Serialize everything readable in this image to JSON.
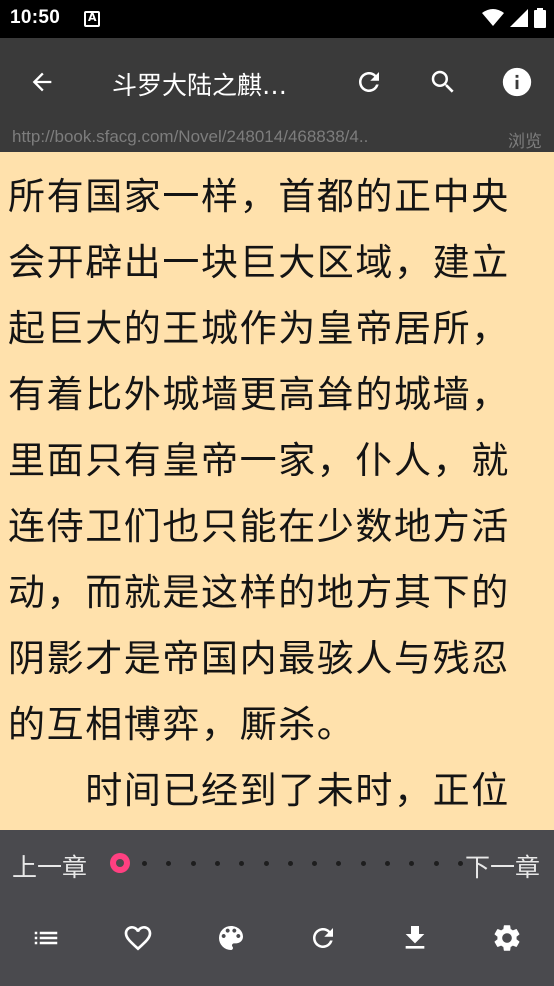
{
  "status_bar": {
    "time": "10:50"
  },
  "app_bar": {
    "title": "斗罗大陆之麒…"
  },
  "url_bar": {
    "url": "http://book.sfacg.com/Novel/248014/468838/4..",
    "browse_label": "浏览"
  },
  "reader": {
    "lines": [
      "所有国家一样，首都的正中央",
      "会开辟出一块巨大区域，建立",
      "起巨大的王城作为皇帝居所，",
      "有着比外城墙更高耸的城墙，",
      "里面只有皇帝一家，仆人，就",
      "连侍卫们也只能在少数地方活",
      "动，而就是这样的地方其下的",
      "阴影才是帝国内最骇人与残忍",
      "的互相博弈，厮杀。",
      "　　时间已经到了未时，正位"
    ]
  },
  "chapter_nav": {
    "prev_label": "上一章",
    "next_label": "下一章",
    "progress": 0
  },
  "toolbar": {
    "icons": [
      "list-icon",
      "heart-icon",
      "palette-icon",
      "refresh-icon",
      "download-icon",
      "settings-icon"
    ]
  },
  "colors": {
    "app_bar": "#3a3a3a",
    "reader_bg": "#ffe1ac",
    "bottom_panel": "#4a4a4e",
    "accent": "#ff4081"
  }
}
